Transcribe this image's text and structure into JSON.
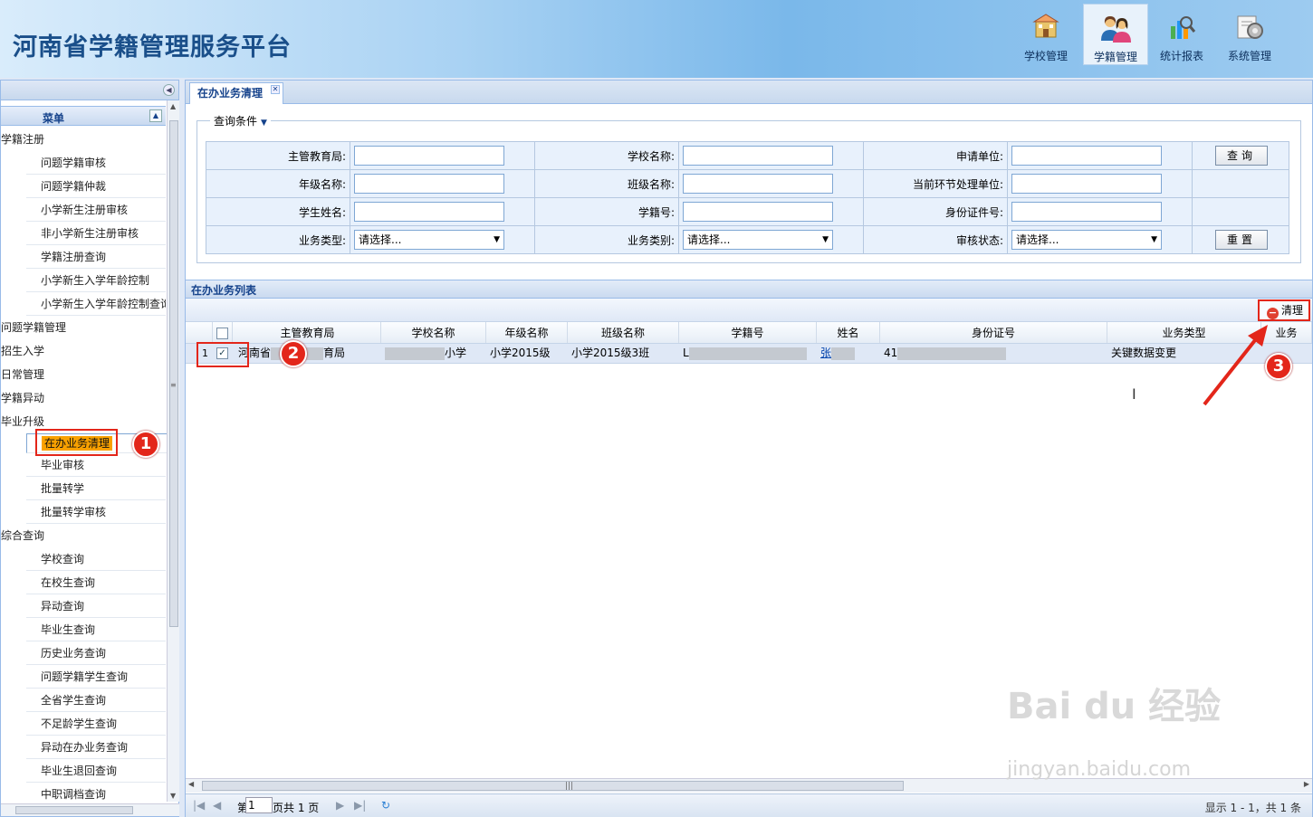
{
  "app_title": "河南省学籍管理服务平台",
  "nav": [
    {
      "label": "学校管理",
      "icon": "school-icon"
    },
    {
      "label": "学籍管理",
      "icon": "students-icon"
    },
    {
      "label": "统计报表",
      "icon": "report-icon"
    },
    {
      "label": "系统管理",
      "icon": "settings-icon"
    }
  ],
  "sidebar": {
    "menu_title": "菜单",
    "items": [
      {
        "label": "学籍注册",
        "type": "group"
      },
      {
        "label": "问题学籍审核",
        "type": "sub"
      },
      {
        "label": "问题学籍仲裁",
        "type": "sub"
      },
      {
        "label": "小学新生注册审核",
        "type": "sub"
      },
      {
        "label": "非小学新生注册审核",
        "type": "sub"
      },
      {
        "label": "学籍注册查询",
        "type": "sub"
      },
      {
        "label": "小学新生入学年龄控制",
        "type": "sub"
      },
      {
        "label": "小学新生入学年龄控制查询",
        "type": "sub"
      },
      {
        "label": "问题学籍管理",
        "type": "group"
      },
      {
        "label": "招生入学",
        "type": "group"
      },
      {
        "label": "日常管理",
        "type": "group"
      },
      {
        "label": "学籍异动",
        "type": "group"
      },
      {
        "label": "毕业升级",
        "type": "group"
      },
      {
        "label": "在办业务清理",
        "type": "sub",
        "selected": true
      },
      {
        "label": "毕业审核",
        "type": "sub"
      },
      {
        "label": "批量转学",
        "type": "sub"
      },
      {
        "label": "批量转学审核",
        "type": "sub"
      },
      {
        "label": "综合查询",
        "type": "group"
      },
      {
        "label": "学校查询",
        "type": "sub"
      },
      {
        "label": "在校生查询",
        "type": "sub"
      },
      {
        "label": "异动查询",
        "type": "sub"
      },
      {
        "label": "毕业生查询",
        "type": "sub"
      },
      {
        "label": "历史业务查询",
        "type": "sub"
      },
      {
        "label": "问题学籍学生查询",
        "type": "sub"
      },
      {
        "label": "全省学生查询",
        "type": "sub"
      },
      {
        "label": "不足龄学生查询",
        "type": "sub"
      },
      {
        "label": "异动在办业务查询",
        "type": "sub"
      },
      {
        "label": "毕业生退回查询",
        "type": "sub"
      },
      {
        "label": "中职调档查询",
        "type": "sub"
      }
    ]
  },
  "tab": {
    "label": "在办业务清理"
  },
  "query": {
    "legend": "查询条件",
    "rows": [
      [
        {
          "label": "主管教育局:",
          "kind": "text"
        },
        {
          "label": "学校名称:",
          "kind": "text"
        },
        {
          "label": "申请单位:",
          "kind": "text"
        }
      ],
      [
        {
          "label": "年级名称:",
          "kind": "text"
        },
        {
          "label": "班级名称:",
          "kind": "text"
        },
        {
          "label": "当前环节处理单位:",
          "kind": "text"
        }
      ],
      [
        {
          "label": "学生姓名:",
          "kind": "text"
        },
        {
          "label": "学籍号:",
          "kind": "text"
        },
        {
          "label": "身份证件号:",
          "kind": "text"
        }
      ],
      [
        {
          "label": "业务类型:",
          "kind": "select",
          "value": "请选择..."
        },
        {
          "label": "业务类别:",
          "kind": "select",
          "value": "请选择..."
        },
        {
          "label": "审核状态:",
          "kind": "select",
          "value": "请选择..."
        }
      ]
    ],
    "search_label": "查询",
    "reset_label": "重置"
  },
  "list": {
    "title": "在办业务列表",
    "clear_label": "清理",
    "columns": [
      "主管教育局",
      "学校名称",
      "年级名称",
      "班级名称",
      "学籍号",
      "姓名",
      "身份证号",
      "业务类型",
      "业务"
    ],
    "rows": [
      {
        "num": "1",
        "checked": true,
        "bureau_a": "河南省",
        "bureau_b": "育局",
        "school": "小学",
        "grade": "小学2015级",
        "class": "小学2015级3班",
        "xjh": "L",
        "name": "张",
        "idno": "41",
        "type": "关键数据变更"
      }
    ]
  },
  "pager": {
    "page_prefix": "第",
    "page_value": "1",
    "page_suffix": "页共 1 页",
    "info": "显示 1 - 1，共 1 条"
  },
  "markers": [
    "1",
    "2",
    "3"
  ],
  "watermark": {
    "main": "Bai du 经验",
    "sub": "jingyan.baidu.com"
  }
}
